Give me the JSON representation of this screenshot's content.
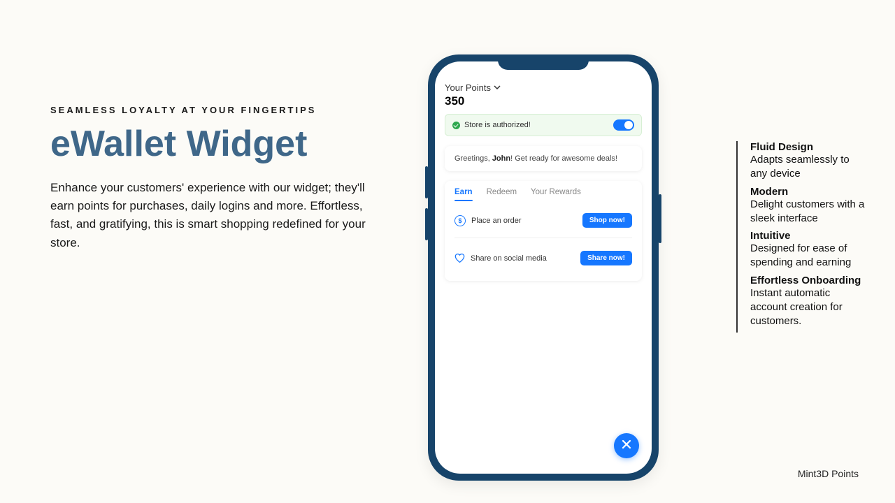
{
  "left": {
    "eyebrow": "SEAMLESS LOYALTY AT YOUR FINGERTIPS",
    "headline": "eWallet Widget",
    "body": "Enhance your customers' experience with our widget; they'll earn points for purchases, daily logins and more. Effortless, fast, and gratifying, this is smart shopping redefined for your store."
  },
  "features": [
    {
      "title": "Fluid Design",
      "desc": "Adapts seamlessly to any device"
    },
    {
      "title": "Modern",
      "desc": "Delight customers with a sleek interface"
    },
    {
      "title": "Intuitive",
      "desc": "Designed for ease of spending and earning"
    },
    {
      "title": "Effortless Onboarding",
      "desc": "Instant automatic account creation for customers."
    }
  ],
  "brand": "Mint3D Points",
  "phone": {
    "points_label": "Your Points",
    "points_value": "350",
    "auth_text": "Store is authorized!",
    "greeting_prefix": "Greetings, ",
    "greeting_name": "John",
    "greeting_suffix": "! Get ready for awesome deals!",
    "tabs": {
      "earn": "Earn",
      "redeem": "Redeem",
      "rewards": "Your Rewards"
    },
    "row1": {
      "label": "Place an order",
      "btn": "Shop now!"
    },
    "row2": {
      "label": "Share on social media",
      "btn": "Share now!"
    }
  }
}
